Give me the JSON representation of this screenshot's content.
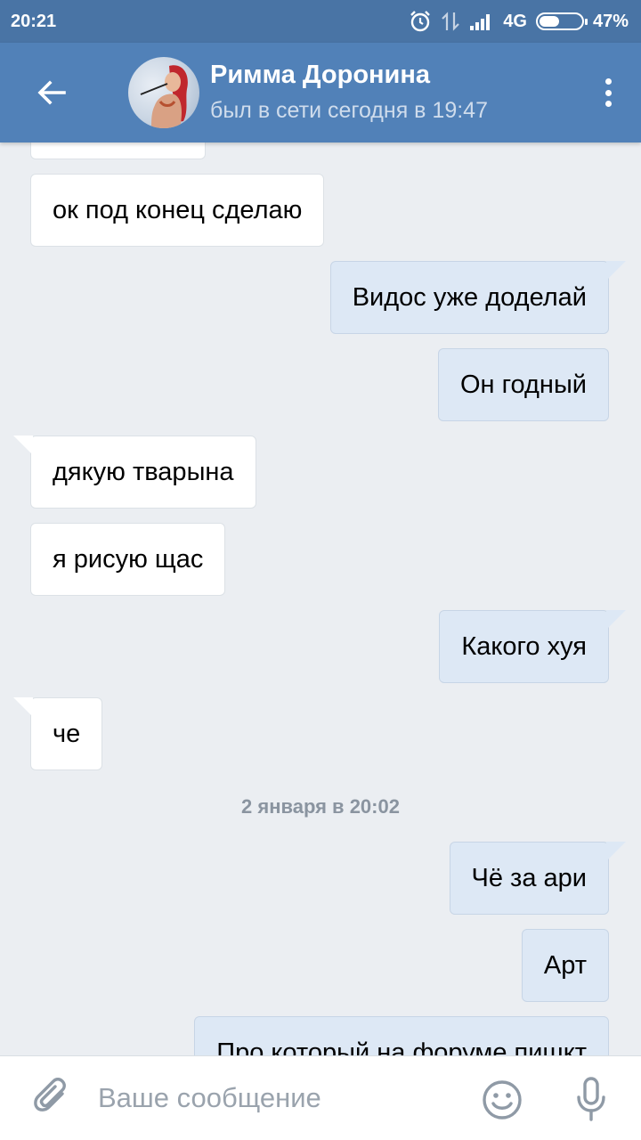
{
  "status_bar": {
    "time": "20:21",
    "network": "4G",
    "battery_percent": "47%",
    "battery_level": 0.47
  },
  "header": {
    "contact_name": "Римма Доронина",
    "contact_status": "был в сети сегодня в 19:47",
    "back_icon": "arrow-left-icon",
    "menu_icon": "more-vertical-icon"
  },
  "messages": [
    {
      "direction": "in",
      "text": "ок под конец сделаю"
    },
    {
      "direction": "out",
      "text": "Видос уже доделай"
    },
    {
      "direction": "out",
      "text": "Он годный"
    },
    {
      "direction": "in",
      "text": "дякую тварына"
    },
    {
      "direction": "in",
      "text": "я рисую щас"
    },
    {
      "direction": "out",
      "text": "Какого хуя"
    },
    {
      "direction": "in",
      "text": "че"
    },
    {
      "direction": "out",
      "text": "Чё за ари"
    },
    {
      "direction": "out",
      "text": "Арт"
    },
    {
      "direction": "out",
      "text": "Про который на форуме пишкт"
    }
  ],
  "date_separator": "2 января в 20:02",
  "composer": {
    "placeholder": "Ваше сообщение",
    "attach_icon": "paperclip-icon",
    "emoji_icon": "smiley-icon",
    "mic_icon": "microphone-icon"
  },
  "colors": {
    "status_bar": "#4974a5",
    "header": "#5181b8",
    "chat_background": "#ebeef2",
    "incoming_bubble": "#ffffff",
    "outgoing_bubble": "#dde8f5"
  }
}
